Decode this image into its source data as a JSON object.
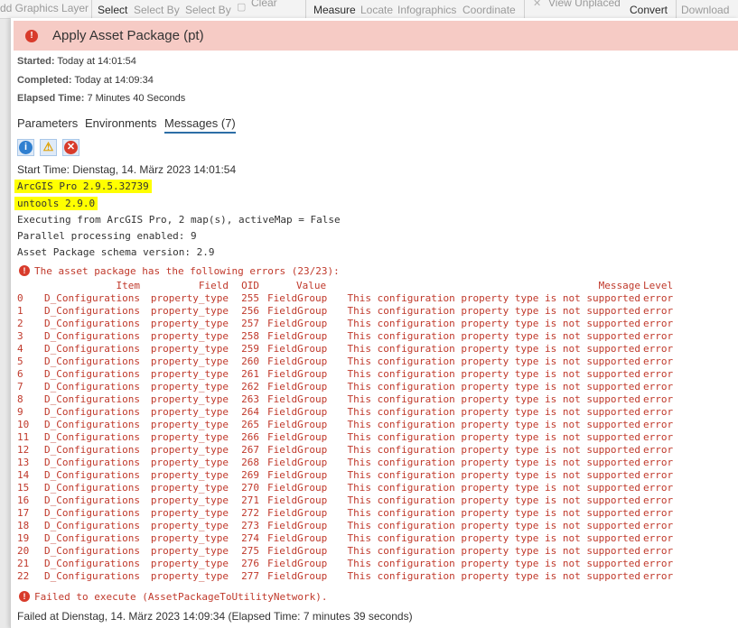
{
  "ribbon": {
    "graphics_layer": "dd Graphics Layer",
    "select": "Select",
    "select_by_attributes": "Select By",
    "select_by_location": "Select By",
    "clear": "Clear",
    "measure": "Measure",
    "locate": "Locate",
    "infographics": "Infographics",
    "coordinate": "Coordinate",
    "view_unplaced": "View Unplaced",
    "convert": "Convert",
    "download": "Download"
  },
  "dialog": {
    "title": "Apply Asset Package (pt)",
    "started_label": "Started:",
    "started_value": "Today at 14:01:54",
    "completed_label": "Completed:",
    "completed_value": "Today at 14:09:34",
    "elapsed_label": "Elapsed Time:",
    "elapsed_value": "7 Minutes 40 Seconds"
  },
  "tabs": [
    {
      "label": "Parameters"
    },
    {
      "label": "Environments"
    },
    {
      "label": "Messages (7)"
    }
  ],
  "filters": {
    "info_icon": "info-icon",
    "warning_icon": "warning-icon",
    "error_icon": "error-icon"
  },
  "messages": {
    "start_time": "Start Time: Dienstag, 14. März 2023 14:01:54",
    "arcgis_version": "ArcGIS Pro 2.9.5.32739",
    "untools_version": "untools 2.9.0",
    "executing": "Executing from ArcGIS Pro, 2 map(s), activeMap = False",
    "parallel": "Parallel processing enabled: 9",
    "schema": "Asset Package schema version: 2.9",
    "errors_header": "The asset package has the following errors (23/23):",
    "failed": "Failed to execute (AssetPackageToUtilityNetwork).",
    "failed_at": "Failed at Dienstag, 14. März 2023 14:09:34 (Elapsed Time: 7 minutes 39 seconds)"
  },
  "error_table": {
    "columns": [
      "Item",
      "Field",
      "OID",
      "Value",
      "Message",
      "Level"
    ],
    "rows": [
      {
        "idx": "0",
        "item": "D_Configurations",
        "field": "property_type",
        "oid": "255",
        "value": "FieldGroup",
        "message": "This configuration property type is not supported",
        "level": "error"
      },
      {
        "idx": "1",
        "item": "D_Configurations",
        "field": "property_type",
        "oid": "256",
        "value": "FieldGroup",
        "message": "This configuration property type is not supported",
        "level": "error"
      },
      {
        "idx": "2",
        "item": "D_Configurations",
        "field": "property_type",
        "oid": "257",
        "value": "FieldGroup",
        "message": "This configuration property type is not supported",
        "level": "error"
      },
      {
        "idx": "3",
        "item": "D_Configurations",
        "field": "property_type",
        "oid": "258",
        "value": "FieldGroup",
        "message": "This configuration property type is not supported",
        "level": "error"
      },
      {
        "idx": "4",
        "item": "D_Configurations",
        "field": "property_type",
        "oid": "259",
        "value": "FieldGroup",
        "message": "This configuration property type is not supported",
        "level": "error"
      },
      {
        "idx": "5",
        "item": "D_Configurations",
        "field": "property_type",
        "oid": "260",
        "value": "FieldGroup",
        "message": "This configuration property type is not supported",
        "level": "error"
      },
      {
        "idx": "6",
        "item": "D_Configurations",
        "field": "property_type",
        "oid": "261",
        "value": "FieldGroup",
        "message": "This configuration property type is not supported",
        "level": "error"
      },
      {
        "idx": "7",
        "item": "D_Configurations",
        "field": "property_type",
        "oid": "262",
        "value": "FieldGroup",
        "message": "This configuration property type is not supported",
        "level": "error"
      },
      {
        "idx": "8",
        "item": "D_Configurations",
        "field": "property_type",
        "oid": "263",
        "value": "FieldGroup",
        "message": "This configuration property type is not supported",
        "level": "error"
      },
      {
        "idx": "9",
        "item": "D_Configurations",
        "field": "property_type",
        "oid": "264",
        "value": "FieldGroup",
        "message": "This configuration property type is not supported",
        "level": "error"
      },
      {
        "idx": "10",
        "item": "D_Configurations",
        "field": "property_type",
        "oid": "265",
        "value": "FieldGroup",
        "message": "This configuration property type is not supported",
        "level": "error"
      },
      {
        "idx": "11",
        "item": "D_Configurations",
        "field": "property_type",
        "oid": "266",
        "value": "FieldGroup",
        "message": "This configuration property type is not supported",
        "level": "error"
      },
      {
        "idx": "12",
        "item": "D_Configurations",
        "field": "property_type",
        "oid": "267",
        "value": "FieldGroup",
        "message": "This configuration property type is not supported",
        "level": "error"
      },
      {
        "idx": "13",
        "item": "D_Configurations",
        "field": "property_type",
        "oid": "268",
        "value": "FieldGroup",
        "message": "This configuration property type is not supported",
        "level": "error"
      },
      {
        "idx": "14",
        "item": "D_Configurations",
        "field": "property_type",
        "oid": "269",
        "value": "FieldGroup",
        "message": "This configuration property type is not supported",
        "level": "error"
      },
      {
        "idx": "15",
        "item": "D_Configurations",
        "field": "property_type",
        "oid": "270",
        "value": "FieldGroup",
        "message": "This configuration property type is not supported",
        "level": "error"
      },
      {
        "idx": "16",
        "item": "D_Configurations",
        "field": "property_type",
        "oid": "271",
        "value": "FieldGroup",
        "message": "This configuration property type is not supported",
        "level": "error"
      },
      {
        "idx": "17",
        "item": "D_Configurations",
        "field": "property_type",
        "oid": "272",
        "value": "FieldGroup",
        "message": "This configuration property type is not supported",
        "level": "error"
      },
      {
        "idx": "18",
        "item": "D_Configurations",
        "field": "property_type",
        "oid": "273",
        "value": "FieldGroup",
        "message": "This configuration property type is not supported",
        "level": "error"
      },
      {
        "idx": "19",
        "item": "D_Configurations",
        "field": "property_type",
        "oid": "274",
        "value": "FieldGroup",
        "message": "This configuration property type is not supported",
        "level": "error"
      },
      {
        "idx": "20",
        "item": "D_Configurations",
        "field": "property_type",
        "oid": "275",
        "value": "FieldGroup",
        "message": "This configuration property type is not supported",
        "level": "error"
      },
      {
        "idx": "21",
        "item": "D_Configurations",
        "field": "property_type",
        "oid": "276",
        "value": "FieldGroup",
        "message": "This configuration property type is not supported",
        "level": "error"
      },
      {
        "idx": "22",
        "item": "D_Configurations",
        "field": "property_type",
        "oid": "277",
        "value": "FieldGroup",
        "message": "This configuration property type is not supported",
        "level": "error"
      }
    ]
  },
  "colors": {
    "header_bg": "#f6cbc5",
    "error_red": "#c0392b",
    "highlight": "#ffff00",
    "tab_underline": "#2d6ea6"
  }
}
